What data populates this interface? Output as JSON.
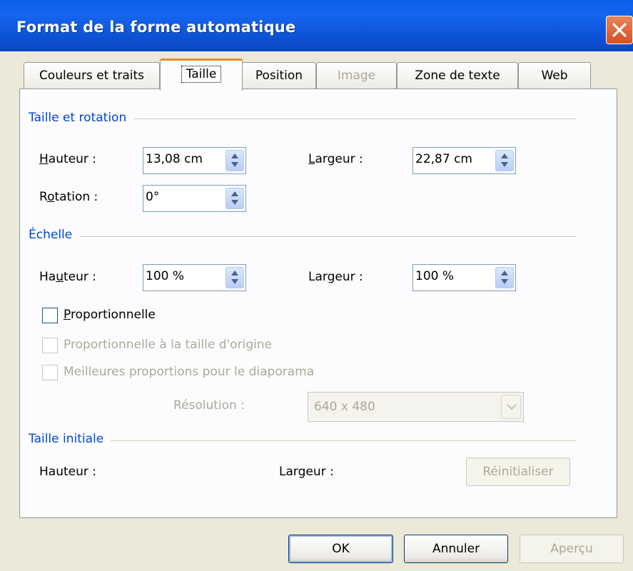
{
  "window": {
    "title": "Format de la forme automatique"
  },
  "tabs": [
    {
      "label": "Couleurs et traits"
    },
    {
      "label": "Taille"
    },
    {
      "label": "Position"
    },
    {
      "label": "Image"
    },
    {
      "label": "Zone de texte"
    },
    {
      "label": "Web"
    }
  ],
  "size_rotation": {
    "section_title": "Taille et rotation",
    "height_label": "Hauteur :",
    "height_value": "13,08 cm",
    "width_label": "Largeur :",
    "width_value": "22,87 cm",
    "rotation_label": "Rotation :",
    "rotation_value": "0°"
  },
  "scale": {
    "section_title": "Échelle",
    "height_label": "Hauteur :",
    "height_value": "100 %",
    "width_label": "Largeur :",
    "width_value": "100 %",
    "lock_aspect_label": "Proportionnelle",
    "relative_original_label": "Proportionnelle à la taille d'origine",
    "best_scale_label": "Meilleures proportions pour le diaporama",
    "resolution_label": "Résolution :",
    "resolution_value": "640 x 480"
  },
  "original_size": {
    "section_title": "Taille initiale",
    "height_label": "Hauteur :",
    "width_label": "Largeur :",
    "reset_label": "Réinitialiser"
  },
  "buttons": {
    "ok": "OK",
    "cancel": "Annuler",
    "preview": "Aperçu"
  }
}
